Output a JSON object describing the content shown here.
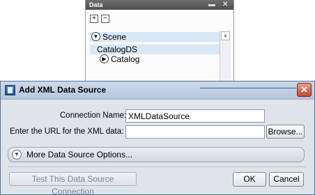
{
  "panel": {
    "title": "Data",
    "tree": {
      "scene": "Scene",
      "datasource": "CatalogDS",
      "child": "Catalog"
    }
  },
  "dialog": {
    "title": "Add XML Data Source",
    "close_label": "✕",
    "connection_name_label": "Connection Name:",
    "connection_name_value": "XMLDataSource",
    "url_label": "Enter the URL for the XML data:",
    "url_value": "",
    "browse_label": "Browse...",
    "more_options_label": "More Data Source Options...",
    "test_label": "Test This Data Source Connection",
    "ok_label": "OK",
    "cancel_label": "Cancel"
  },
  "colors": {
    "dialog_bg": "#dfe3ea",
    "titlebar": "#c3d3e6",
    "close_button": "#c64a2e",
    "selection": "#d7e7f5"
  }
}
